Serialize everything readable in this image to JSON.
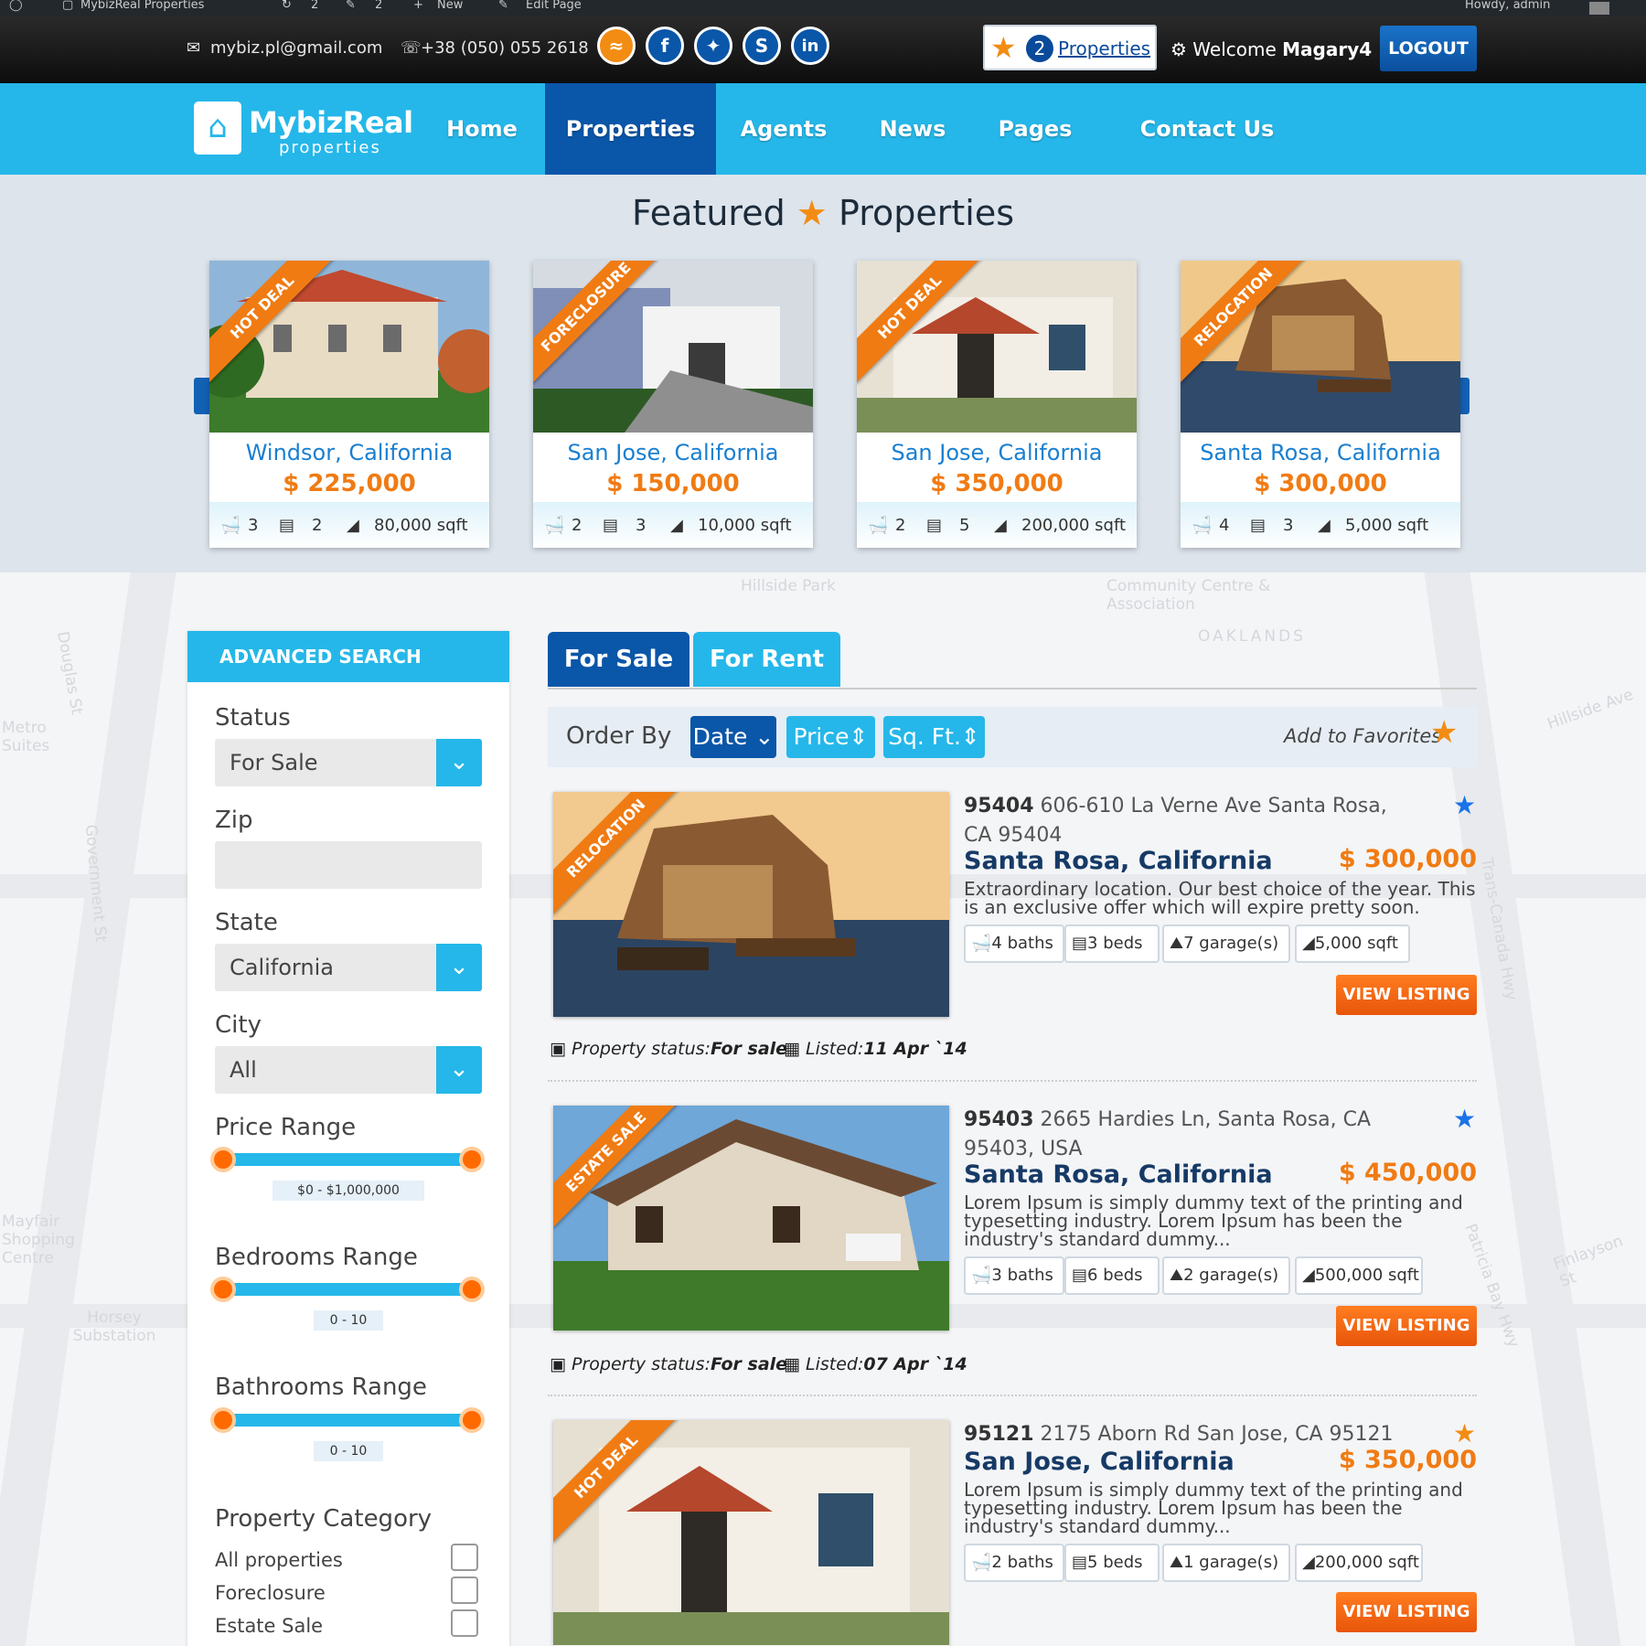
{
  "admin_bar": {
    "site": "MybizReal Properties",
    "comments": "2",
    "updates": "2",
    "new": "New",
    "edit": "Edit Page",
    "howdy": "Howdy, admin"
  },
  "topbar": {
    "email": "mybiz.pl@gmail.com",
    "phone": "+38 (050) 055 2618",
    "social": [
      "rss-icon",
      "facebook-icon",
      "twitter-icon",
      "skype-icon",
      "linkedin-icon"
    ],
    "fav_count": "2",
    "fav_label": "Properties",
    "welcome": "Welcome",
    "username": "Magary4",
    "logout": "LOGOUT"
  },
  "nav": {
    "logo_main": "MybizReal",
    "logo_sub": "properties",
    "items": [
      "Home",
      "Properties",
      "Agents",
      "News",
      "Pages",
      "Contact Us"
    ],
    "active": "Properties"
  },
  "featured": {
    "title_left": "Featured",
    "title_right": "Properties",
    "cards": [
      {
        "ribbon": "HOT DEAL",
        "city": "Windsor, California",
        "price": "$ 225,000",
        "baths": "3",
        "beds": "2",
        "sqft": "80,000 sqft"
      },
      {
        "ribbon": "FORECLOSURE",
        "city": "San Jose, California",
        "price": "$ 150,000",
        "baths": "2",
        "beds": "3",
        "sqft": "10,000 sqft"
      },
      {
        "ribbon": "HOT DEAL",
        "city": "San Jose, California",
        "price": "$ 350,000",
        "baths": "2",
        "beds": "5",
        "sqft": "200,000 sqft"
      },
      {
        "ribbon": "RELOCATION",
        "city": "Santa Rosa, California",
        "price": "$ 300,000",
        "baths": "4",
        "beds": "3",
        "sqft": "5,000 sqft"
      }
    ]
  },
  "map_labels": [
    "Hillside Park",
    "Community Centre & Association",
    "OAKLANDS",
    "Douglas St",
    "Government St",
    "Trans-Canada Hwy",
    "Patricia Bay Hwy",
    "Horsey Substation",
    "Hillside Ave",
    "Metro Suites",
    "Mayfair Shopping Centre",
    "Finlayson St"
  ],
  "search": {
    "title": "ADVANCED SEARCH",
    "status_label": "Status",
    "status_value": "For Sale",
    "zip_label": "Zip",
    "zip_value": "",
    "state_label": "State",
    "state_value": "California",
    "city_label": "City",
    "city_value": "All",
    "price_label": "Price Range",
    "price_value": "$0 - $1,000,000",
    "beds_label": "Bedrooms Range",
    "beds_value": "0 - 10",
    "baths_label": "Bathrooms Range",
    "baths_value": "0 - 10",
    "category_label": "Property Category",
    "categories": [
      "All properties",
      "Foreclosure",
      "Estate Sale"
    ]
  },
  "tabs": [
    "For Sale",
    "For Rent"
  ],
  "order": {
    "label": "Order By",
    "date": "Date",
    "price": "Price",
    "sqft": "Sq. Ft.",
    "add_fav": "Add to Favorites"
  },
  "listings": [
    {
      "ribbon": "RELOCATION",
      "zip": "95404",
      "address": "606-610 La Verne Ave Santa Rosa, CA 95404",
      "city": "Santa Rosa, California",
      "price": "$ 300,000",
      "desc": "Extraordinary location. Our best choice of the year. This is an exclusive offer which will expire pretty soon.",
      "baths": "4 baths",
      "beds": "3 beds",
      "garage": "7 garage(s)",
      "sqft": "5,000 sqft",
      "status_label": "Property status:",
      "status": "For sale",
      "listed_label": "Listed:",
      "listed": "11 Apr `14",
      "fav_color": "#1a73e8"
    },
    {
      "ribbon": "ESTATE SALE",
      "zip": "95403",
      "address": "2665 Hardies Ln, Santa Rosa, CA 95403, USA",
      "city": "Santa Rosa, California",
      "price": "$ 450,000",
      "desc": "Lorem Ipsum is simply dummy text of the printing and typesetting industry. Lorem Ipsum has been the industry's standard dummy...",
      "baths": "3 baths",
      "beds": "6 beds",
      "garage": "2 garage(s)",
      "sqft": "500,000 sqft",
      "status_label": "Property status:",
      "status": "For sale",
      "listed_label": "Listed:",
      "listed": "07 Apr `14",
      "fav_color": "#1a73e8"
    },
    {
      "ribbon": "HOT DEAL",
      "zip": "95121",
      "address": "2175 Aborn Rd San Jose, CA 95121",
      "city": "San Jose, California",
      "price": "$ 350,000",
      "desc": "Lorem Ipsum is simply dummy text of the printing and typesetting industry. Lorem Ipsum has been the industry's standard dummy...",
      "baths": "2 baths",
      "beds": "5 beds",
      "garage": "1 garage(s)",
      "sqft": "200,000 sqft",
      "button": "VIEW LISTING",
      "fav_color": "#f28c13"
    }
  ],
  "view_listing": "VIEW LISTING",
  "colors": {
    "primary": "#25b7e9",
    "dark_blue": "#0a56a8",
    "accent": "#f07b13"
  }
}
